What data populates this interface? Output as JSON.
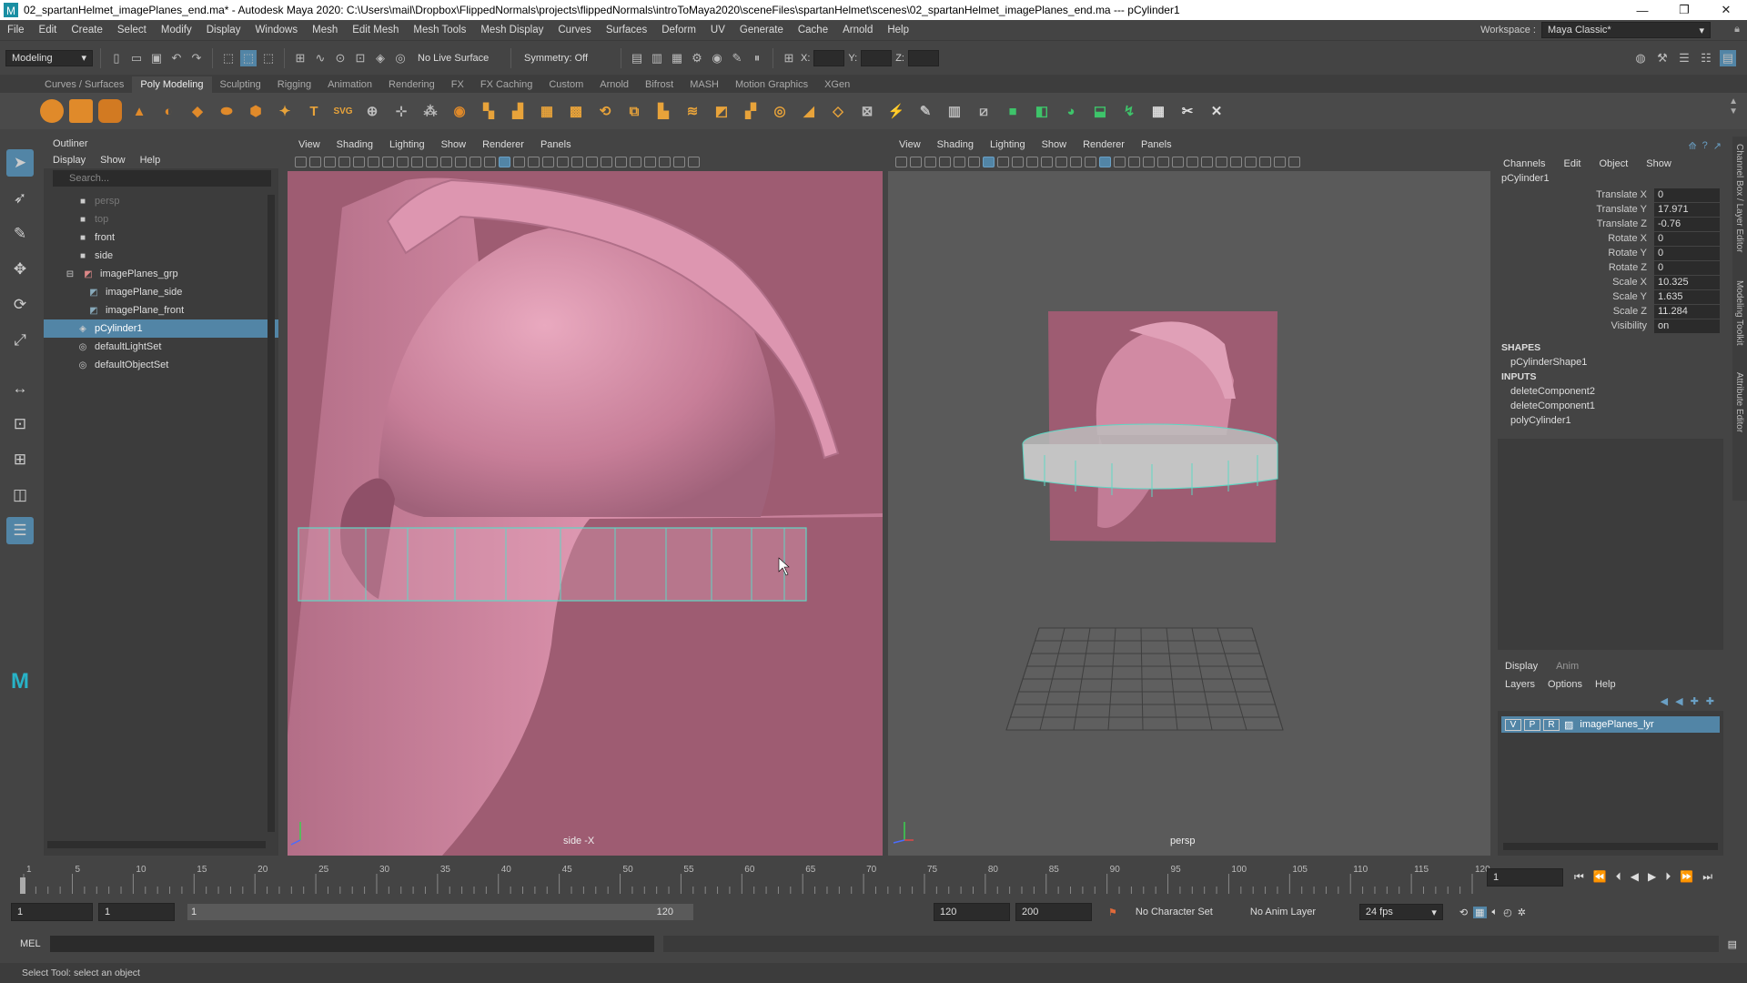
{
  "window": {
    "title": "02_spartanHelmet_imagePlanes_end.ma* - Autodesk Maya 2020: C:\\Users\\mail\\Dropbox\\FlippedNormals\\projects\\flippedNormals\\introToMaya2020\\sceneFiles\\spartanHelmet\\scenes\\02_spartanHelmet_imagePlanes_end.ma  ---  pCylinder1",
    "minimize": "—",
    "maximize": "❐",
    "close": "✕"
  },
  "menubar": {
    "items": [
      "File",
      "Edit",
      "Create",
      "Select",
      "Modify",
      "Display",
      "Windows",
      "Mesh",
      "Edit Mesh",
      "Mesh Tools",
      "Mesh Display",
      "Curves",
      "Surfaces",
      "Deform",
      "UV",
      "Generate",
      "Cache",
      "Arnold",
      "Help"
    ],
    "workspace_label": "Workspace :",
    "workspace_value": "Maya Classic*"
  },
  "statusline": {
    "mode": "Modeling",
    "live_surface": "No Live Surface",
    "symmetry": "Symmetry: Off",
    "x_label": "X:",
    "y_label": "Y:",
    "z_label": "Z:"
  },
  "shelf": {
    "tabs": [
      "Curves / Surfaces",
      "Poly Modeling",
      "Sculpting",
      "Rigging",
      "Animation",
      "Rendering",
      "FX",
      "FX Caching",
      "Custom",
      "Arnold",
      "Bifrost",
      "MASH",
      "Motion Graphics",
      "XGen"
    ],
    "active_tab": "Poly Modeling",
    "text_icon": "T",
    "svg_icon": "SVG"
  },
  "outliner": {
    "title": "Outliner",
    "menu": [
      "Display",
      "Show",
      "Help"
    ],
    "search_placeholder": "Search...",
    "items": [
      {
        "label": "persp",
        "dim": true
      },
      {
        "label": "top",
        "dim": true
      },
      {
        "label": "front"
      },
      {
        "label": "side"
      },
      {
        "label": "imagePlanes_grp"
      },
      {
        "label": "imagePlane_side"
      },
      {
        "label": "imagePlane_front"
      },
      {
        "label": "pCylinder1",
        "selected": true
      },
      {
        "label": "defaultLightSet"
      },
      {
        "label": "defaultObjectSet"
      }
    ]
  },
  "viewport_left": {
    "menu": [
      "View",
      "Shading",
      "Lighting",
      "Show",
      "Renderer",
      "Panels"
    ],
    "camera_label": "side -X",
    "bg_color": "#9e5c72"
  },
  "viewport_right": {
    "menu": [
      "View",
      "Shading",
      "Lighting",
      "Show",
      "Renderer",
      "Panels"
    ],
    "camera_label": "persp",
    "bg_color": "#5a5a5a"
  },
  "channel_box": {
    "menu": [
      "Channels",
      "Edit",
      "Object",
      "Show"
    ],
    "object_name": "pCylinder1",
    "attributes": [
      {
        "name": "Translate X",
        "value": "0"
      },
      {
        "name": "Translate Y",
        "value": "17.971"
      },
      {
        "name": "Translate Z",
        "value": "-0.76"
      },
      {
        "name": "Rotate X",
        "value": "0"
      },
      {
        "name": "Rotate Y",
        "value": "0"
      },
      {
        "name": "Rotate Z",
        "value": "0"
      },
      {
        "name": "Scale X",
        "value": "10.325"
      },
      {
        "name": "Scale Y",
        "value": "1.635"
      },
      {
        "name": "Scale Z",
        "value": "11.284"
      },
      {
        "name": "Visibility",
        "value": "on"
      }
    ],
    "shapes_header": "SHAPES",
    "shapes": [
      "pCylinderShape1"
    ],
    "inputs_header": "INPUTS",
    "inputs": [
      "deleteComponent2",
      "deleteComponent1",
      "polyCylinder1"
    ],
    "side_tab_1": "Channel Box / Layer Editor",
    "side_tab_2": "Modeling Toolkit",
    "side_tab_3": "Attribute Editor"
  },
  "layer_editor": {
    "tabs": [
      "Display",
      "Anim"
    ],
    "menu": [
      "Layers",
      "Options",
      "Help"
    ],
    "layer": {
      "v": "V",
      "p": "P",
      "r": "R",
      "name": "imagePlanes_lyr"
    }
  },
  "timeline": {
    "ticks": [
      1,
      5,
      10,
      15,
      20,
      25,
      30,
      35,
      40,
      45,
      50,
      55,
      60,
      65,
      70,
      75,
      80,
      85,
      90,
      95,
      100,
      105,
      110,
      115,
      120
    ],
    "current_frame": "1"
  },
  "range": {
    "start": "1",
    "playback_start": "1",
    "slider_left": "1",
    "slider_right": "120",
    "playback_end": "120",
    "end": "200",
    "character_set": "No Character Set",
    "anim_layer": "No Anim Layer",
    "fps": "24 fps"
  },
  "cmdline": {
    "label": "MEL"
  },
  "helpline": {
    "text": "Select Tool: select an object"
  },
  "colors": {
    "accent": "#5285a6",
    "helmet": "#d18aa3",
    "cage": "#5fd7c4"
  }
}
